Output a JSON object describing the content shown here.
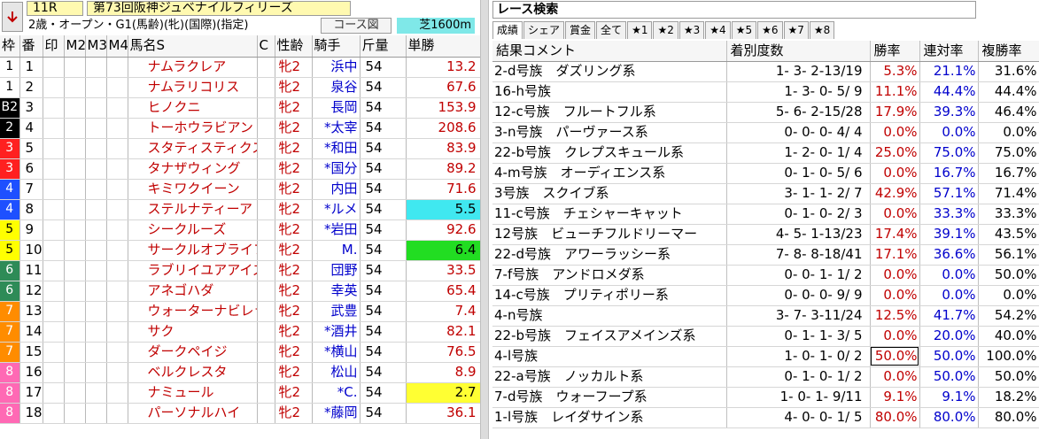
{
  "race": {
    "number": "11R",
    "name": "第73回阪神ジュベナイルフィリーズ",
    "conditions": "2歳・オープン・G1(馬齢)(牝)(国際)(指定)",
    "course_button": "コース図",
    "distance": "芝1600m"
  },
  "left_headers": [
    "枠",
    "番",
    "印",
    "M2",
    "M3",
    "M4",
    "馬名S",
    "C",
    "性齢",
    "騎手",
    "斤量",
    "単勝"
  ],
  "horses": [
    {
      "waku": "1",
      "uma": "1",
      "name": "ナムラクレア",
      "sex": "牝2",
      "jockey": "浜中",
      "kin": "54",
      "odds": "13.2",
      "odds_bg": ""
    },
    {
      "waku": "1",
      "uma": "2",
      "name": "ナムラリコリス",
      "sex": "牝2",
      "jockey": "泉谷",
      "kin": "54",
      "odds": "67.6",
      "odds_bg": ""
    },
    {
      "waku": "B2",
      "uma": "3",
      "name": "ヒノクニ",
      "sex": "牝2",
      "jockey": "長岡",
      "kin": "54",
      "odds": "153.9",
      "odds_bg": ""
    },
    {
      "waku": "2",
      "uma": "4",
      "name": "トーホウラビアン",
      "sex": "牝2",
      "jockey": "*太宰",
      "kin": "54",
      "odds": "208.6",
      "odds_bg": ""
    },
    {
      "waku": "3",
      "uma": "5",
      "name": "スタティスティクス",
      "sex": "牝2",
      "jockey": "*和田",
      "kin": "54",
      "odds": "83.9",
      "odds_bg": ""
    },
    {
      "waku": "3",
      "uma": "6",
      "name": "タナザウィング",
      "sex": "牝2",
      "jockey": "*国分",
      "kin": "54",
      "odds": "89.2",
      "odds_bg": ""
    },
    {
      "waku": "4",
      "uma": "7",
      "name": "キミワクイーン",
      "sex": "牝2",
      "jockey": "内田",
      "kin": "54",
      "odds": "71.6",
      "odds_bg": ""
    },
    {
      "waku": "4",
      "uma": "8",
      "name": "ステルナティーア",
      "sex": "牝2",
      "jockey": "*ルメ",
      "kin": "54",
      "odds": "5.5",
      "odds_bg": "#40e8f0"
    },
    {
      "waku": "5",
      "uma": "9",
      "name": "シークルーズ",
      "sex": "牝2",
      "jockey": "*岩田",
      "kin": "54",
      "odds": "92.6",
      "odds_bg": ""
    },
    {
      "waku": "5",
      "uma": "10",
      "name": "サークルオブライフ",
      "sex": "牝2",
      "jockey": "M.",
      "kin": "54",
      "odds": "6.4",
      "odds_bg": "#22dd22"
    },
    {
      "waku": "6",
      "uma": "11",
      "name": "ラブリイユアアイズ",
      "sex": "牝2",
      "jockey": "団野",
      "kin": "54",
      "odds": "33.5",
      "odds_bg": ""
    },
    {
      "waku": "6",
      "uma": "12",
      "name": "アネゴハダ",
      "sex": "牝2",
      "jockey": "幸英",
      "kin": "54",
      "odds": "65.4",
      "odds_bg": ""
    },
    {
      "waku": "7",
      "uma": "13",
      "name": "ウォーターナビレラ",
      "sex": "牝2",
      "jockey": "武豊",
      "kin": "54",
      "odds": "7.4",
      "odds_bg": ""
    },
    {
      "waku": "7",
      "uma": "14",
      "name": "サク",
      "sex": "牝2",
      "jockey": "*酒井",
      "kin": "54",
      "odds": "82.1",
      "odds_bg": ""
    },
    {
      "waku": "7",
      "uma": "15",
      "name": "ダークペイジ",
      "sex": "牝2",
      "jockey": "*横山",
      "kin": "54",
      "odds": "76.5",
      "odds_bg": ""
    },
    {
      "waku": "8",
      "uma": "16",
      "name": "ベルクレスタ",
      "sex": "牝2",
      "jockey": "松山",
      "kin": "54",
      "odds": "8.9",
      "odds_bg": ""
    },
    {
      "waku": "8",
      "uma": "17",
      "name": "ナミュール",
      "sex": "牝2",
      "jockey": "*C.",
      "kin": "54",
      "odds": "2.7",
      "odds_bg": "#ffff33"
    },
    {
      "waku": "8",
      "uma": "18",
      "name": "パーソナルハイ",
      "sex": "牝2",
      "jockey": "*藤岡",
      "kin": "54",
      "odds": "36.1",
      "odds_bg": ""
    }
  ],
  "waku_colors": {
    "1": {
      "bg": "#ffffff",
      "fg": "#000000"
    },
    "B2": {
      "bg": "#000000",
      "fg": "#ffffff"
    },
    "2": {
      "bg": "#000000",
      "fg": "#ffffff"
    },
    "3": {
      "bg": "#ff2020",
      "fg": "#ffffff"
    },
    "4": {
      "bg": "#1e50ff",
      "fg": "#ffffff"
    },
    "5": {
      "bg": "#ffff00",
      "fg": "#000000"
    },
    "6": {
      "bg": "#2e8b57",
      "fg": "#ffffff"
    },
    "7": {
      "bg": "#ff8c00",
      "fg": "#ffffff"
    },
    "8": {
      "bg": "#ff69b4",
      "fg": "#ffffff"
    }
  },
  "search": {
    "title": "レース検索",
    "tabs": [
      "成績",
      "シェア",
      "賞金",
      "全て",
      "★1",
      "★2",
      "★3",
      "★4",
      "★5",
      "★6",
      "★7",
      "★8"
    ]
  },
  "right_headers": [
    "結果コメント",
    "着別度数",
    "勝率",
    "連対率",
    "複勝率"
  ],
  "results": [
    {
      "comment": "2-d号族　ダズリング系",
      "record": "1- 3- 2-13/19",
      "win": "5.3%",
      "ren": "21.1%",
      "fuku": "31.6%",
      "boxed": false
    },
    {
      "comment": "16-h号族",
      "record": "1- 3- 0- 5/ 9",
      "win": "11.1%",
      "ren": "44.4%",
      "fuku": "44.4%",
      "boxed": false
    },
    {
      "comment": "12-c号族　フルートフル系",
      "record": "5- 6- 2-15/28",
      "win": "17.9%",
      "ren": "39.3%",
      "fuku": "46.4%",
      "boxed": false
    },
    {
      "comment": "3-n号族　パーヴァース系",
      "record": "0- 0- 0- 4/ 4",
      "win": "0.0%",
      "ren": "0.0%",
      "fuku": "0.0%",
      "boxed": false
    },
    {
      "comment": "22-b号族　クレプスキュール系",
      "record": "1- 2- 0- 1/ 4",
      "win": "25.0%",
      "ren": "75.0%",
      "fuku": "75.0%",
      "boxed": false
    },
    {
      "comment": "4-m号族　オーディエンス系",
      "record": "0- 1- 0- 5/ 6",
      "win": "0.0%",
      "ren": "16.7%",
      "fuku": "16.7%",
      "boxed": false
    },
    {
      "comment": "3号族　スクイブ系",
      "record": "3- 1- 1- 2/ 7",
      "win": "42.9%",
      "ren": "57.1%",
      "fuku": "71.4%",
      "boxed": false
    },
    {
      "comment": "11-c号族　チェシャーキャット",
      "record": "0- 1- 0- 2/ 3",
      "win": "0.0%",
      "ren": "33.3%",
      "fuku": "33.3%",
      "boxed": false
    },
    {
      "comment": "12号族　ビューチフルドリーマー",
      "record": "4- 5- 1-13/23",
      "win": "17.4%",
      "ren": "39.1%",
      "fuku": "43.5%",
      "boxed": false
    },
    {
      "comment": "22-d号族　アワーラッシー系",
      "record": "7- 8- 8-18/41",
      "win": "17.1%",
      "ren": "36.6%",
      "fuku": "56.1%",
      "boxed": false
    },
    {
      "comment": "7-f号族　アンドロメダ系",
      "record": "0- 0- 1- 1/ 2",
      "win": "0.0%",
      "ren": "0.0%",
      "fuku": "50.0%",
      "boxed": false
    },
    {
      "comment": "14-c号族　プリティポリー系",
      "record": "0- 0- 0- 9/ 9",
      "win": "0.0%",
      "ren": "0.0%",
      "fuku": "0.0%",
      "boxed": false
    },
    {
      "comment": "4-n号族",
      "record": "3- 7- 3-11/24",
      "win": "12.5%",
      "ren": "41.7%",
      "fuku": "54.2%",
      "boxed": false
    },
    {
      "comment": "22-b号族　フェイスアメインズ系",
      "record": "0- 1- 1- 3/ 5",
      "win": "0.0%",
      "ren": "20.0%",
      "fuku": "40.0%",
      "boxed": false
    },
    {
      "comment": "4-l号族",
      "record": "1- 0- 1- 0/ 2",
      "win": "50.0%",
      "ren": "50.0%",
      "fuku": "100.0%",
      "boxed": true
    },
    {
      "comment": "22-a号族　ノッカルト系",
      "record": "0- 1- 0- 1/ 2",
      "win": "0.0%",
      "ren": "50.0%",
      "fuku": "50.0%",
      "boxed": false
    },
    {
      "comment": "7-d号族　ウォーフープ系",
      "record": "1- 0- 1- 9/11",
      "win": "9.1%",
      "ren": "9.1%",
      "fuku": "18.2%",
      "boxed": false
    },
    {
      "comment": "1-l号族　レイダサイン系",
      "record": "4- 0- 0- 1/ 5",
      "win": "80.0%",
      "ren": "80.0%",
      "fuku": "80.0%",
      "boxed": false
    }
  ]
}
